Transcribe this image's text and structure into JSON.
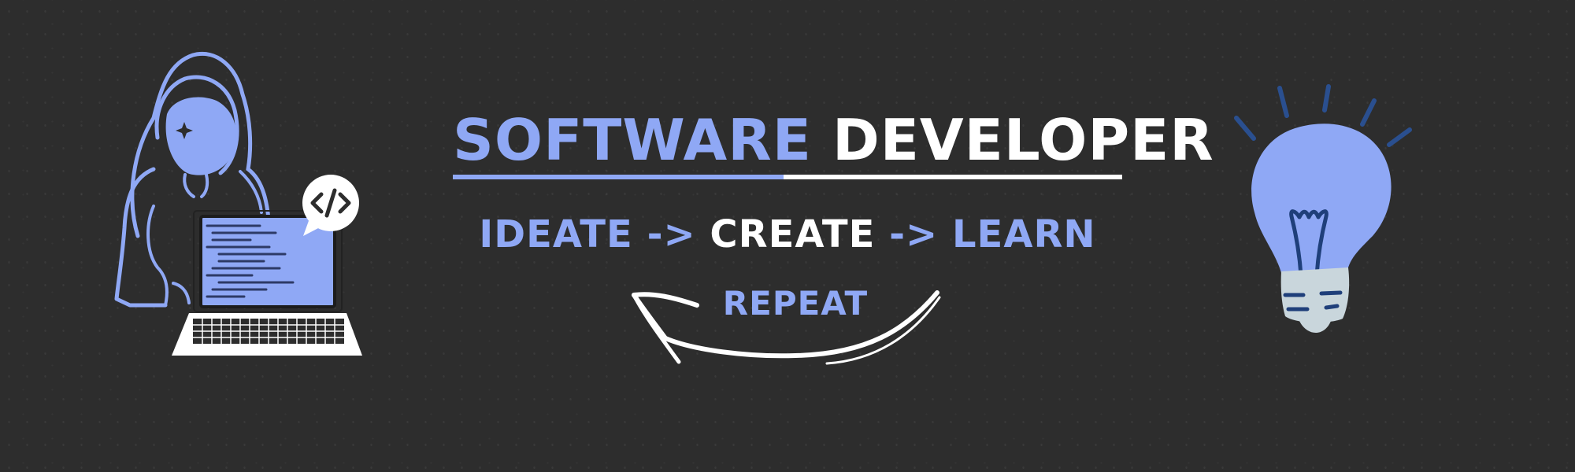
{
  "title": {
    "word1": "SOFTWARE",
    "word2": "DEVELOPER"
  },
  "process": {
    "step1": "IDEATE",
    "arrow1": "->",
    "step2": "CREATE",
    "arrow2": "->",
    "step3": "LEARN"
  },
  "repeat_label": "REPEAT",
  "colors": {
    "background": "#2d2d2d",
    "accent": "#8fa8f5",
    "text": "#ffffff",
    "dark_blue": "#1f3f7a",
    "bulb_base": "#c9d6dc"
  },
  "icons": {
    "left": "hooded-developer-laptop-icon",
    "code_bubble": "code-bubble-icon",
    "right": "lightbulb-icon",
    "cycle_arrow": "curved-arrow-icon"
  }
}
